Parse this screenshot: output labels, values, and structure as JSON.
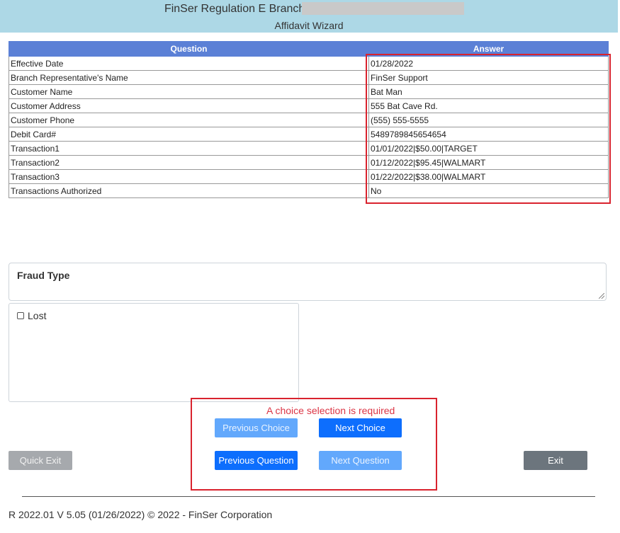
{
  "header": {
    "title": "FinSer Regulation E Branch -",
    "subtitle": "Affidavit Wizard"
  },
  "table": {
    "headers": {
      "question": "Question",
      "answer": "Answer"
    },
    "rows": [
      {
        "question": "Effective Date",
        "answer": "01/28/2022"
      },
      {
        "question": "Branch Representative's Name",
        "answer": "FinSer Support"
      },
      {
        "question": "Customer Name",
        "answer": "Bat Man"
      },
      {
        "question": "Customer Address",
        "answer": "555 Bat Cave Rd."
      },
      {
        "question": "Customer Phone",
        "answer": "(555) 555-5555"
      },
      {
        "question": "Debit Card#",
        "answer": "5489789845654654"
      },
      {
        "question": "Transaction1",
        "answer": "01/01/2022|$50.00|TARGET"
      },
      {
        "question": "Transaction2",
        "answer": "01/12/2022|$95.45|WALMART"
      },
      {
        "question": "Transaction3",
        "answer": "01/22/2022|$38.00|WALMART"
      },
      {
        "question": "Transactions Authorized",
        "answer": "No"
      }
    ]
  },
  "fraud": {
    "label": "Fraud Type",
    "choices": [
      {
        "label": "Lost",
        "checked": false
      }
    ]
  },
  "validation": {
    "error": "A choice selection is required"
  },
  "buttons": {
    "previous_choice": "Previous Choice",
    "next_choice": "Next Choice",
    "previous_question": "Previous Question",
    "next_question": "Next Question",
    "quick_exit": "Quick Exit",
    "exit": "Exit"
  },
  "colors": {
    "header_bg": "#add8e6",
    "table_header_bg": "#5b80d6",
    "highlight_border": "#d9232e",
    "error": "#dc3545",
    "primary": "#0d6efd"
  },
  "footer": {
    "text": "R 2022.01 V 5.05 (01/26/2022) © 2022 - FinSer Corporation"
  }
}
